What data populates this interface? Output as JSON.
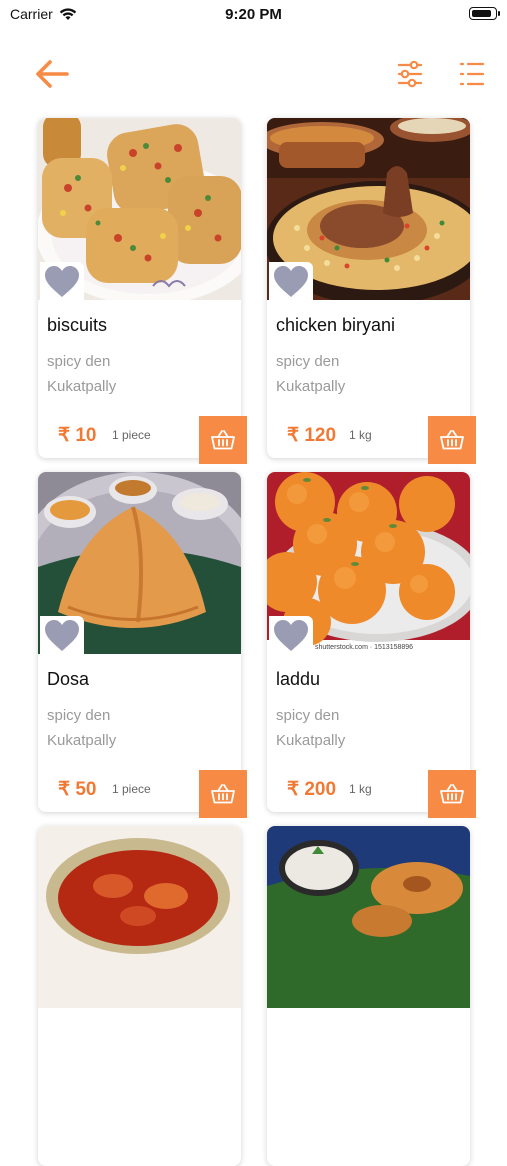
{
  "status_bar": {
    "carrier": "Carrier",
    "time": "9:20 PM",
    "battery_level": 0.9
  },
  "colors": {
    "accent": "#f78a45",
    "price": "#f07a35",
    "muted": "#9a9a9a",
    "heart": "#9a9cb4"
  },
  "nav": {
    "back_icon": "arrow-left-icon",
    "filter_icon": "sliders-icon",
    "list_icon": "list-icon"
  },
  "products": [
    {
      "name": "biscuits",
      "shop": "spicy den",
      "location": "Kukatpally",
      "price": "₹ 10",
      "unit": "1 piece"
    },
    {
      "name": "chicken biryani",
      "shop": "spicy den",
      "location": "Kukatpally",
      "price": "₹ 120",
      "unit": "1 kg"
    },
    {
      "name": "Dosa",
      "shop": "spicy den",
      "location": "Kukatpally",
      "price": "₹ 50",
      "unit": "1 piece"
    },
    {
      "name": "laddu",
      "shop": "spicy den",
      "location": "Kukatpally",
      "price": "₹ 200",
      "unit": "1 kg",
      "image_caption": "shutterstock.com · 1513158896"
    }
  ]
}
